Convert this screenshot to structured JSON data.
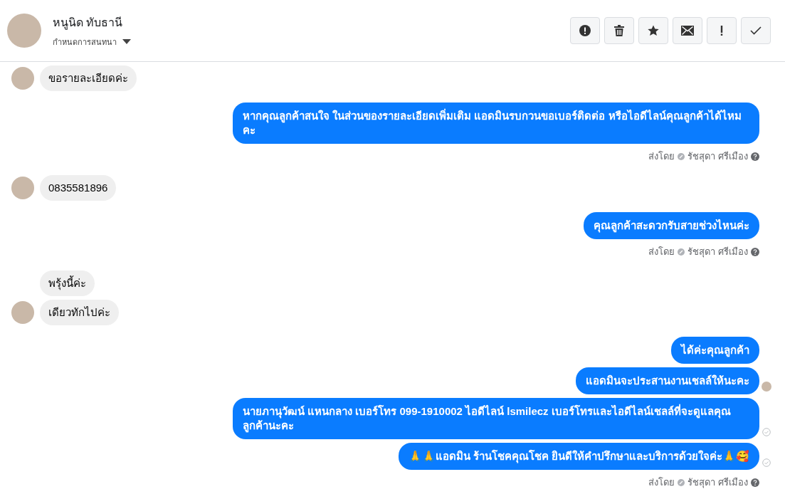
{
  "header": {
    "name": "หนูนิด ทับธานี",
    "subtitle": "กำหนดการสนทนา"
  },
  "actions": [
    {
      "kind": "alert"
    },
    {
      "kind": "trash"
    },
    {
      "kind": "star"
    },
    {
      "kind": "mail"
    },
    {
      "kind": "exclaim"
    },
    {
      "kind": "check"
    }
  ],
  "groups": [
    {
      "kind": "incoming",
      "messages": [
        {
          "text": "ขอรายละเอียดค่ะ"
        }
      ]
    },
    {
      "kind": "outgoing",
      "messages": [
        {
          "text": "หากคุณลูกค้าสนใจ ในส่วนของรายละเอียดเพิ่มเติม แอดมินรบกวนขอเบอร์ติดต่อ หรือไอดีไลน์คุณลูกค้าได้ไหมคะ",
          "seen": false,
          "delivered": false
        }
      ],
      "sent_by": {
        "label": "ส่งโดย",
        "name": "รัชสุดา ศรีเมือง"
      }
    },
    {
      "kind": "incoming",
      "messages": [
        {
          "text": "0835581896"
        }
      ]
    },
    {
      "kind": "outgoing",
      "messages": [
        {
          "text": "คุณลูกค้าสะดวกรับสายช่วงไหนค่ะ",
          "seen": false,
          "delivered": false
        }
      ],
      "sent_by": {
        "label": "ส่งโดย",
        "name": "รัชสุดา ศรีเมือง"
      }
    },
    {
      "kind": "incoming",
      "messages": [
        {
          "text": "พรุ้งนี้ค่ะ"
        },
        {
          "text": "เดียวทักไปค่ะ"
        }
      ]
    },
    {
      "kind": "outgoing",
      "messages": [
        {
          "text": "ได้ค่ะคุณลูกค้า",
          "seen": false,
          "delivered": false
        },
        {
          "text": "แอดมินจะประสานงานเชลล์ให้นะคะ",
          "seen": true,
          "delivered": false
        },
        {
          "text": "นายภานุวัฒน์ แหนกลาง เบอร์โทร 099-1910002 ไอดีไลน์ lsmilecz   เบอร์โทรและไอดีไลน์เชลล์ที่จะดูแลคุณลูกค้านะคะ",
          "seen": false,
          "delivered": true
        },
        {
          "text": "🙏🙏แอดมิน ร้านโชคคุณโชค ยินดีให้คำปรึกษาและบริการด้วยใจค่ะ🙏🥰",
          "seen": false,
          "delivered": true
        }
      ],
      "sent_by": {
        "label": "ส่งโดย",
        "name": "รัชสุดา ศรีเมือง"
      }
    }
  ]
}
